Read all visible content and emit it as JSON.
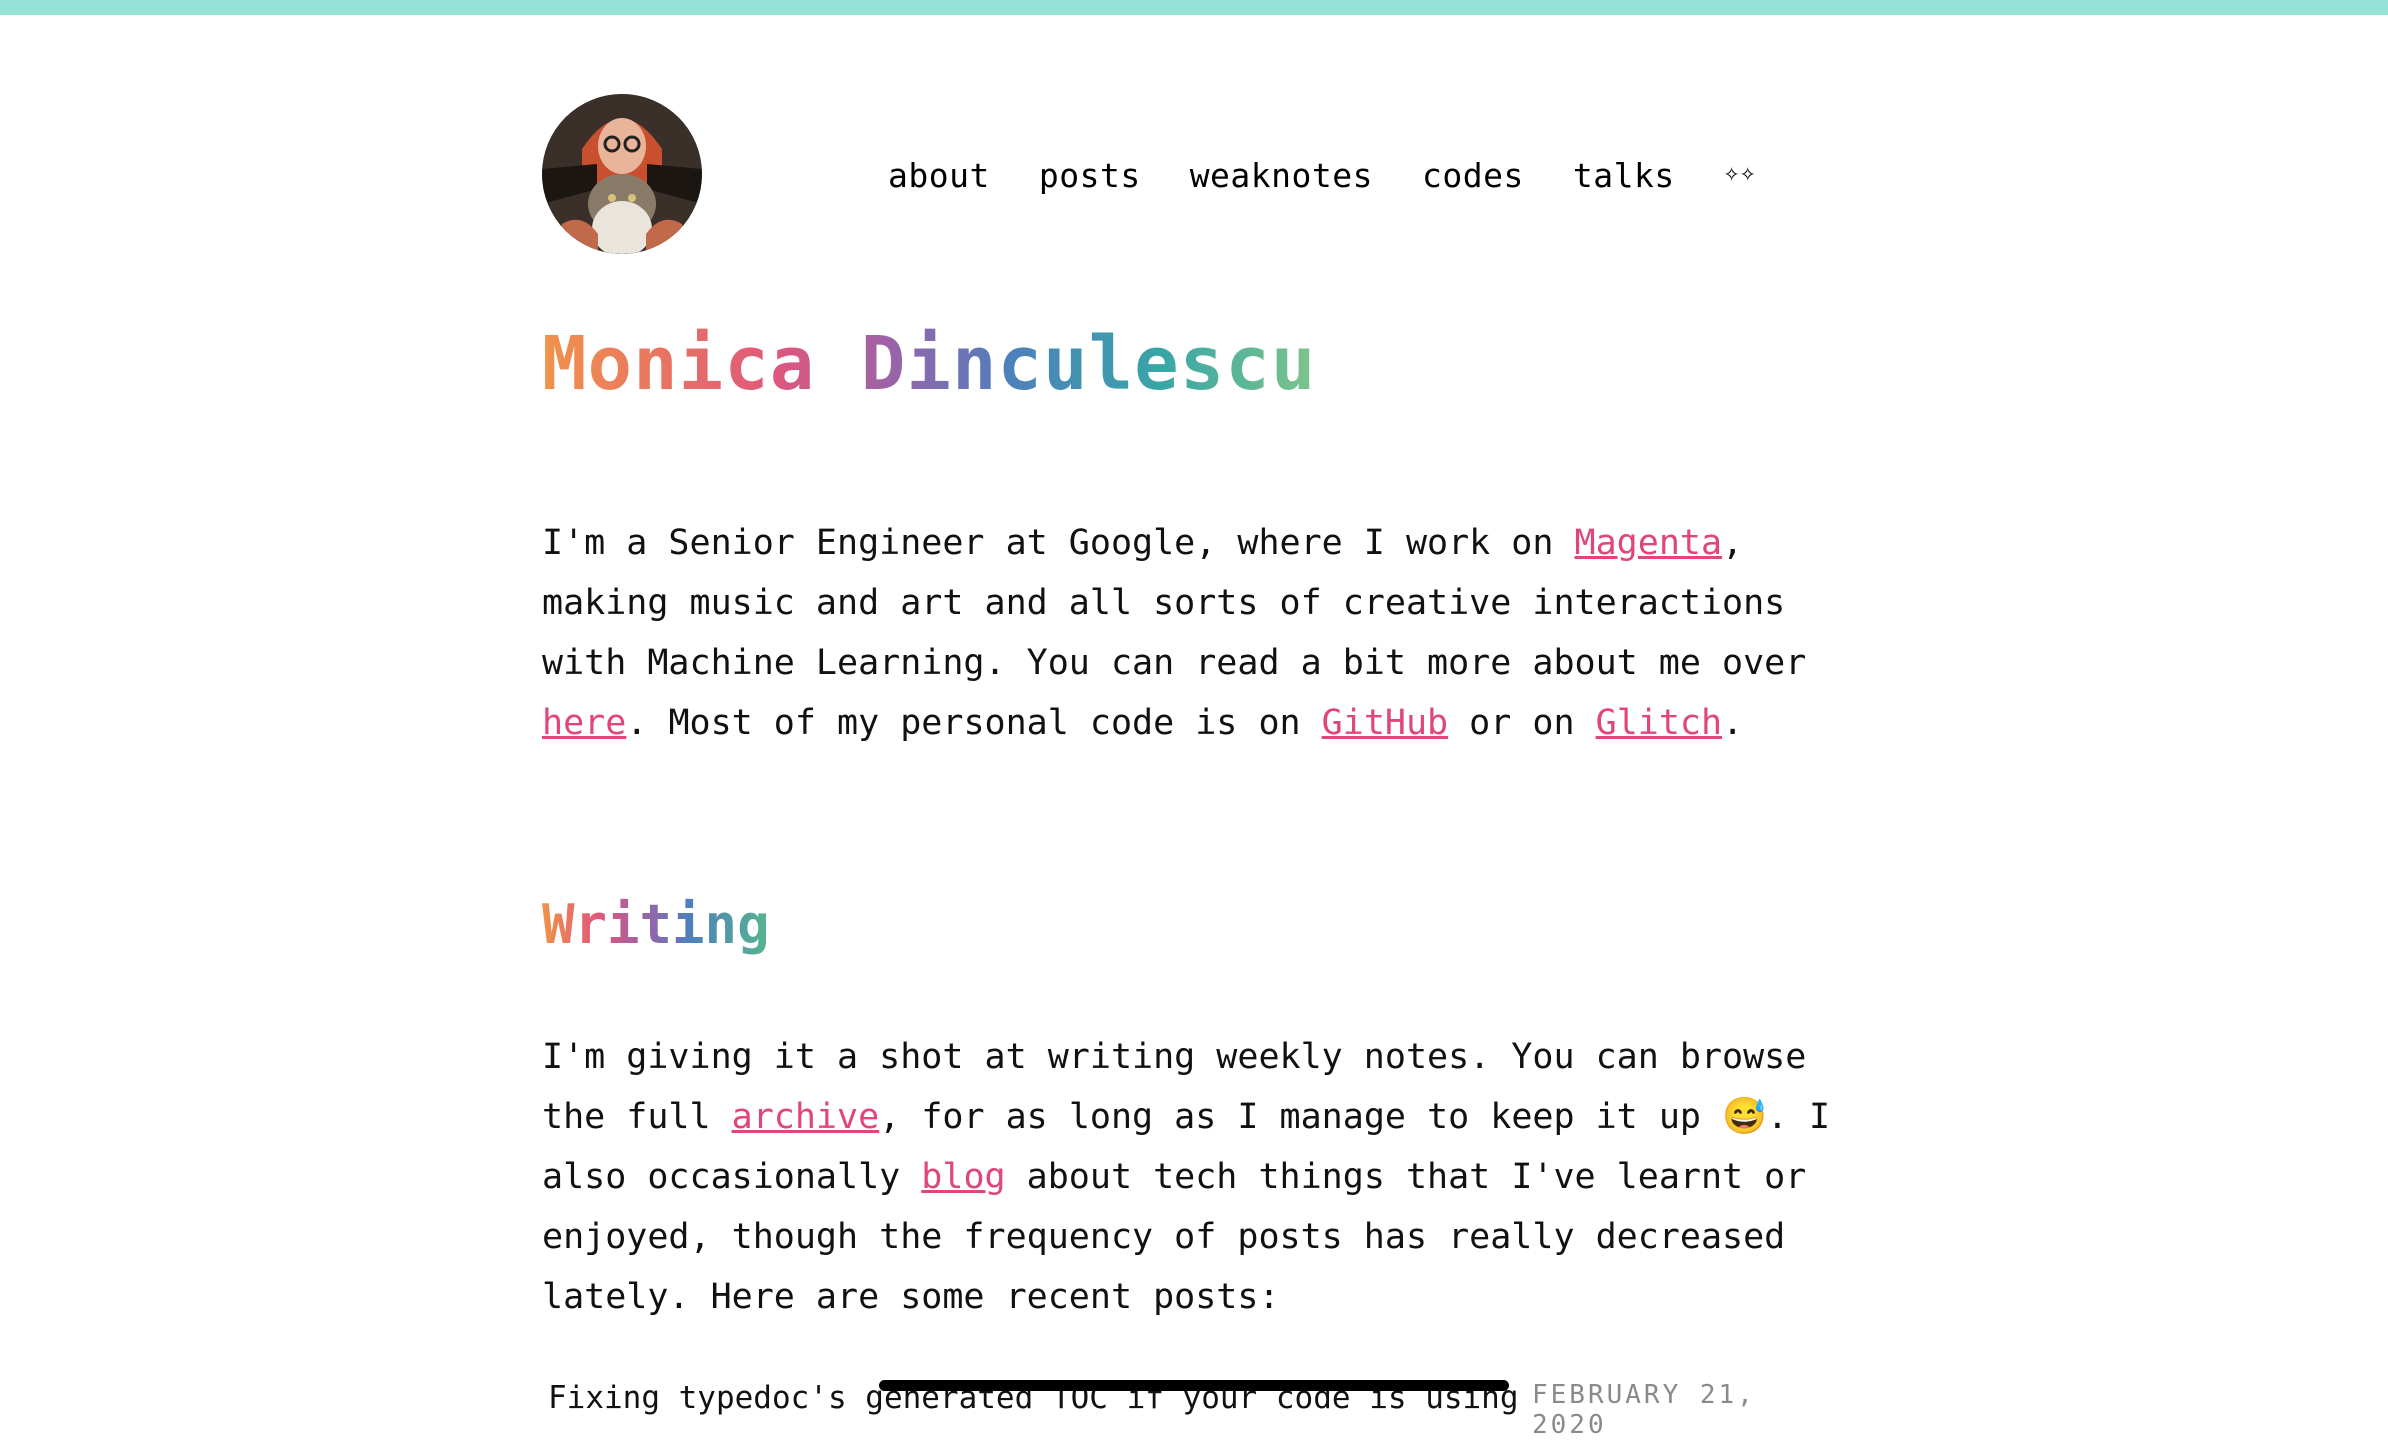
{
  "header": {
    "nav": [
      "about",
      "posts",
      "weaknotes",
      "codes",
      "talks"
    ],
    "sparkles": "✧✧"
  },
  "title": "Monica Dinculescu",
  "intro": {
    "p1": "I'm a Senior Engineer at Google, where I work on ",
    "link_magenta": "Magenta",
    "p2": ", making music and art and all sorts of creative interactions with Machine Learning. You can read a bit more about me over ",
    "link_here": "here",
    "p3": ". Most of my personal code is on ",
    "link_github": "GitHub",
    "p4": " or on ",
    "link_glitch": "Glitch",
    "p5": "."
  },
  "writing": {
    "heading": "Writing",
    "p1": "I'm giving it a shot at writing weekly notes. You can browse the full ",
    "link_archive": "archive",
    "p2": ", for as long as I manage to keep it up ",
    "emoji": "😅",
    "p3": ". I also occasionally ",
    "link_blog": "blog",
    "p4": " about tech things that I've learnt or enjoyed, though the frequency of posts has really decreased lately. Here are some recent posts:"
  },
  "posts": [
    {
      "title": "Fixing typedoc's generated TOC if your code is using",
      "date": "FEBRUARY 21, 2020"
    }
  ],
  "colors": {
    "accent": "#e0457b",
    "topbar": "#95e3d6"
  }
}
